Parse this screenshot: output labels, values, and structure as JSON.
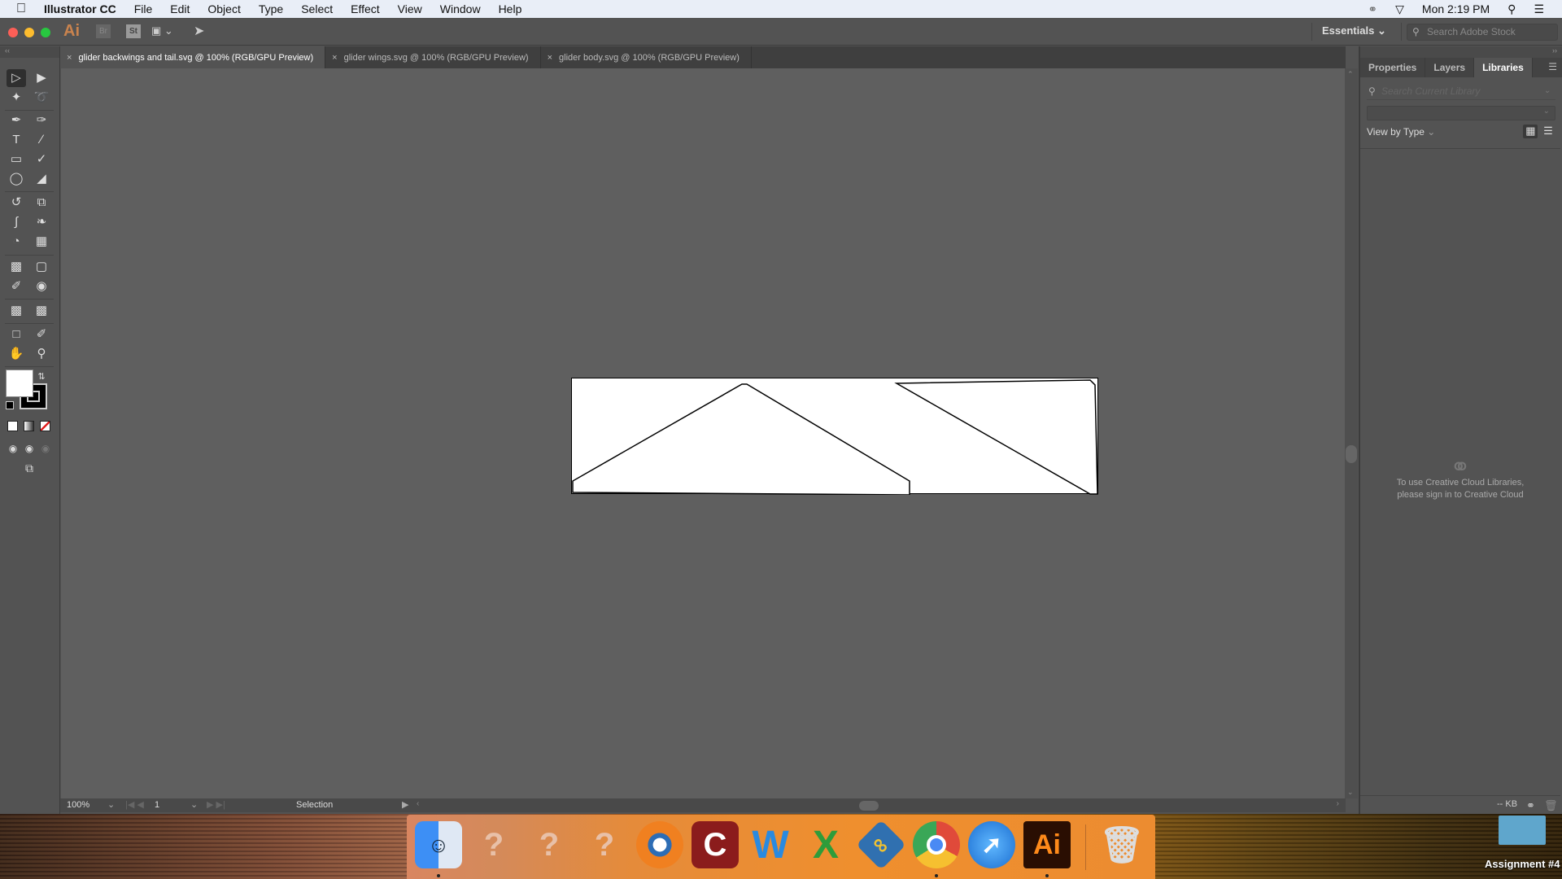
{
  "menubar": {
    "app_name": "Illustrator CC",
    "items": [
      "File",
      "Edit",
      "Object",
      "Type",
      "Select",
      "Effect",
      "View",
      "Window",
      "Help"
    ],
    "clock": "Mon 2:19 PM"
  },
  "app_toolbar": {
    "logo": "Ai",
    "bridge": "Br",
    "stock": "St",
    "workspace": "Essentials",
    "stock_search_placeholder": "Search Adobe Stock"
  },
  "doc_tabs": [
    {
      "label": "glider backwings and tail.svg @ 100% (RGB/GPU Preview)",
      "active": true
    },
    {
      "label": "glider wings.svg @ 100% (RGB/GPU Preview)",
      "active": false
    },
    {
      "label": "glider body.svg @ 100% (RGB/GPU Preview)",
      "active": false
    }
  ],
  "tools": {
    "selected": "selection-tool",
    "fill_color": "#ffffff",
    "stroke_color": "#000000"
  },
  "status_bar": {
    "zoom": "100%",
    "artboard": "1",
    "mode": "Selection"
  },
  "panel": {
    "tabs": [
      "Properties",
      "Layers",
      "Libraries"
    ],
    "active_tab": "Libraries",
    "search_placeholder": "Search Current Library",
    "view_by": "View by Type",
    "message_line1": "To use Creative Cloud Libraries,",
    "message_line2": "please sign in to Creative Cloud",
    "storage": "-- KB"
  },
  "dock": {
    "apps": [
      "Finder",
      "?",
      "?",
      "?",
      "Blender",
      "C",
      "Word",
      "Excel",
      "Fetch",
      "Chrome",
      "Safari",
      "Illustrator",
      "Trash"
    ],
    "ai_label": "Ai"
  },
  "desktop": {
    "folder_label": "Assignment #4"
  },
  "colors": {
    "accent_ai": "#ff9a00",
    "canvas": "#5f5f5f"
  }
}
